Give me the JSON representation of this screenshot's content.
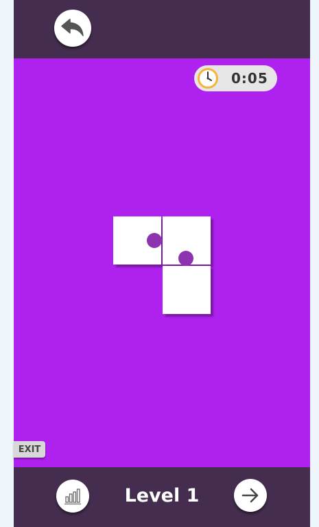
{
  "icons": {
    "back": "back-arrow-icon",
    "clock": "clock-icon",
    "stats": "bar-chart-icon",
    "next": "arrow-right-icon"
  },
  "colors": {
    "frame": "#442d4e",
    "board": "#ae21ee",
    "tile": "#ffffff",
    "dot": "#8e33b0",
    "page_background": "#eef6fc"
  },
  "timer": {
    "value": "0:05"
  },
  "puzzle": {
    "tile_count": 3,
    "dot_count": 2
  },
  "exit_label": "EXIT",
  "level_label": "Level 1"
}
